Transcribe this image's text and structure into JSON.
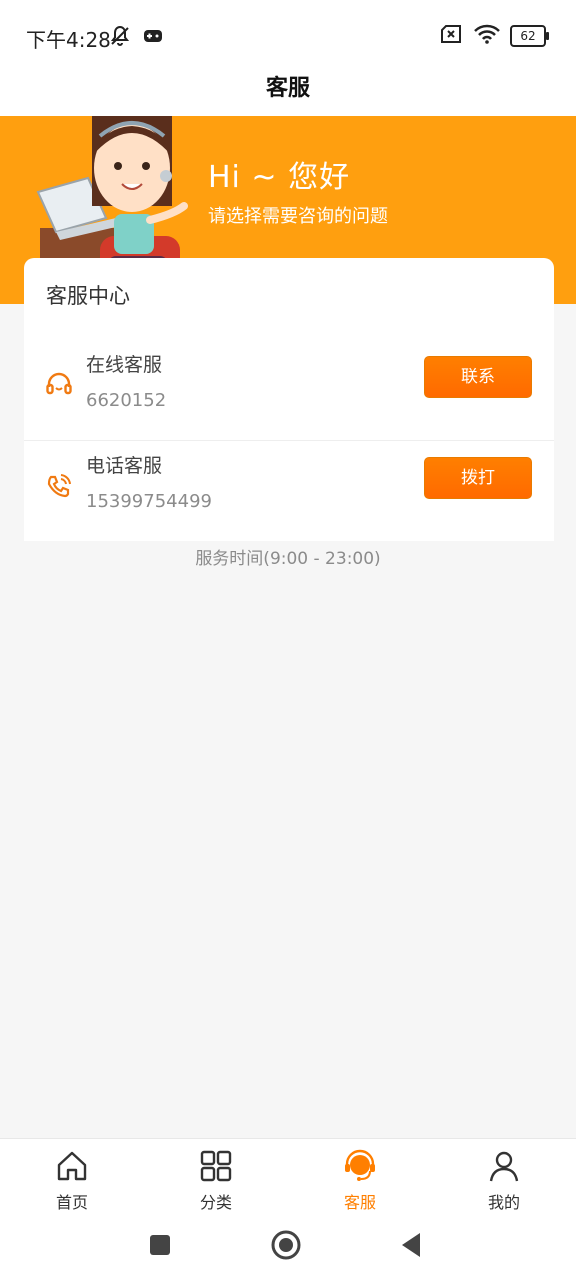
{
  "status_bar": {
    "time": "下午4:28",
    "battery": "62"
  },
  "header": {
    "title": "客服"
  },
  "banner": {
    "greeting": "Hi ~ 您好",
    "subtitle": "请选择需要咨询的问题"
  },
  "card": {
    "title": "客服中心",
    "rows": [
      {
        "name": "在线客服",
        "value": "6620152",
        "button": "联系",
        "icon": "headset-icon"
      },
      {
        "name": "电话客服",
        "value": "15399754499",
        "button": "拨打",
        "icon": "phone-icon"
      }
    ]
  },
  "service_time": "服务时间(9:00 - 23:00)",
  "tabs": [
    {
      "label": "首页",
      "icon": "home-icon"
    },
    {
      "label": "分类",
      "icon": "grid-icon"
    },
    {
      "label": "客服",
      "icon": "customer-service-icon"
    },
    {
      "label": "我的",
      "icon": "user-icon"
    }
  ],
  "colors": {
    "accent": "#ff7f00",
    "banner": "#ff9f0f"
  }
}
